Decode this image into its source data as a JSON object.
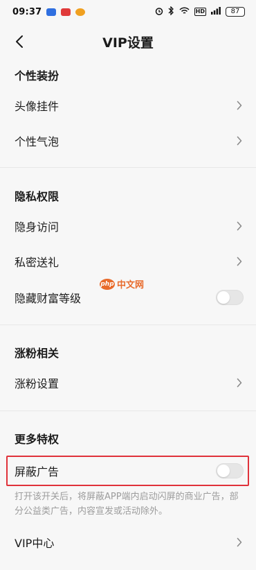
{
  "status_bar": {
    "time": "09:37",
    "signal_label": "HD",
    "battery": "87"
  },
  "nav": {
    "title": "VIP设置"
  },
  "sections": {
    "personal": {
      "header": "个性装扮",
      "items": [
        "头像挂件",
        "个性气泡"
      ]
    },
    "privacy": {
      "header": "隐私权限",
      "items": [
        "隐身访问",
        "私密送礼",
        "隐藏财富等级"
      ]
    },
    "fans": {
      "header": "涨粉相关",
      "items": [
        "涨粉设置"
      ]
    },
    "more": {
      "header": "更多特权",
      "items": [
        "屏蔽广告",
        "VIP中心"
      ],
      "ad_block_description": "打开该开关后，将屏蔽APP端内启动闪屏的商业广告，部分公益类广告，内容宣发或活动除外。"
    }
  },
  "toggles": {
    "hide_wealth_level": false,
    "block_ads": false
  },
  "watermark": {
    "logo": "php",
    "text": "中文网"
  },
  "colors": {
    "highlight": "#e0323a",
    "background": "#f7f7f7",
    "watermark": "#e86b2c"
  }
}
